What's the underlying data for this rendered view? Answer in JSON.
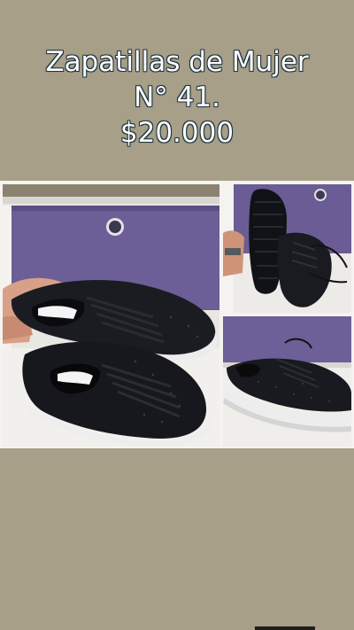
{
  "post": {
    "title_line1": "Zapatillas de Mujer",
    "title_line2": "N° 41.",
    "title_line3": "$20.000"
  },
  "colors": {
    "background": "#a79f88",
    "title_fill": "#ffffff",
    "title_outline": "#243a44"
  },
  "photos": [
    {
      "name": "main-photo",
      "subject": "pair-of-black-sneakers"
    },
    {
      "name": "sole-photo",
      "subject": "sneaker-sole-and-top-view"
    },
    {
      "name": "side-photo",
      "subject": "sneaker-side-view"
    }
  ]
}
